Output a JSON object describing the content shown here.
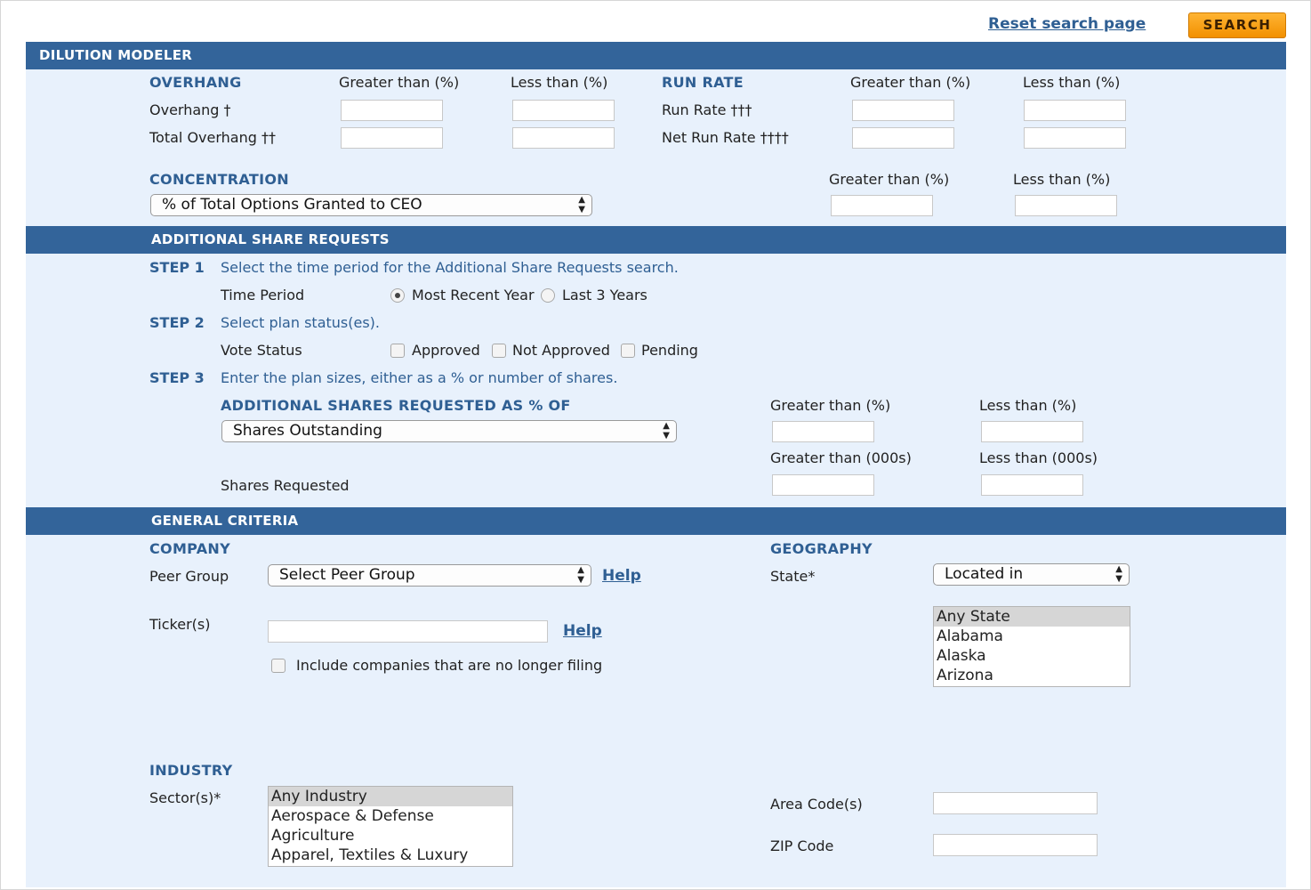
{
  "top": {
    "reset_link": "Reset search page",
    "search_button": "SEARCH"
  },
  "dilution": {
    "title": "DILUTION MODELER",
    "overhang": {
      "heading": "OVERHANG",
      "col_gt": "Greater than (%)",
      "col_lt": "Less than (%)",
      "rows": [
        "Overhang †",
        "Total Overhang ††"
      ]
    },
    "run_rate": {
      "heading": "RUN RATE",
      "col_gt": "Greater than (%)",
      "col_lt": "Less than (%)",
      "rows": [
        "Run Rate †††",
        "Net Run Rate ††††"
      ]
    },
    "concentration": {
      "heading": "CONCENTRATION",
      "select_value": "% of Total Options Granted to CEO",
      "col_gt": "Greater than (%)",
      "col_lt": "Less than (%)"
    }
  },
  "asr": {
    "title": "ADDITIONAL SHARE REQUESTS",
    "step1": {
      "label": "STEP 1",
      "text": "Select the time period for the Additional Share Requests search."
    },
    "time_period": {
      "label": "Time Period",
      "options": [
        "Most Recent Year",
        "Last 3 Years"
      ],
      "selected": "Most Recent Year"
    },
    "step2": {
      "label": "STEP 2",
      "text": "Select plan status(es)."
    },
    "vote_status": {
      "label": "Vote Status",
      "options": [
        "Approved",
        "Not Approved",
        "Pending"
      ]
    },
    "step3": {
      "label": "STEP 3",
      "text": "Enter the plan sizes, either as a % or number of shares."
    },
    "pct_heading": "ADDITIONAL SHARES REQUESTED AS % OF",
    "pct_select": "Shares Outstanding",
    "col_gt_pct": "Greater than (%)",
    "col_lt_pct": "Less than (%)",
    "col_gt_000": "Greater than (000s)",
    "col_lt_000": "Less than (000s)",
    "shares_requested": "Shares Requested"
  },
  "general": {
    "title": "GENERAL CRITERIA",
    "company": {
      "heading": "COMPANY",
      "peer_label": "Peer Group",
      "peer_select": "Select Peer Group",
      "help": "Help",
      "ticker_label": "Ticker(s)",
      "include_label": "Include companies that are no longer filing"
    },
    "geography": {
      "heading": "GEOGRAPHY",
      "state_label": "State*",
      "state_select": "Located in",
      "states": [
        "Any State",
        "Alabama",
        "Alaska",
        "Arizona"
      ],
      "area_code_label": "Area Code(s)",
      "zip_label": "ZIP Code"
    },
    "industry": {
      "heading": "INDUSTRY",
      "sector_label": "Sector(s)*",
      "sectors": [
        "Any Industry",
        "Aerospace & Defense",
        "Agriculture",
        "Apparel, Textiles & Luxury Goods"
      ]
    }
  }
}
